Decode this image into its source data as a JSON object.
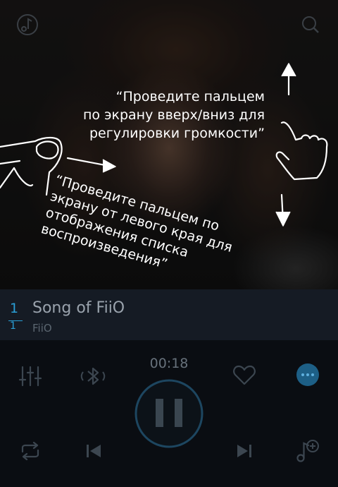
{
  "header": {
    "left_icon": "music-note-icon",
    "right_icon": "search-icon"
  },
  "hints": {
    "volume": "“Проведите пальцем\nпо экрану вверх/вниз для\nрегулировки громкости”",
    "playlist": "“Проведите пальцем по\nэкрану от левого края для\nотображения списка\nвоспроизведения”"
  },
  "track": {
    "number": "1",
    "number_secondary": "1",
    "title": "Song of FiiO",
    "artist": "FiiO"
  },
  "player": {
    "time": "00:18",
    "accent_color": "#2a9fd6",
    "icons": [
      "equalizer-icon",
      "bluetooth-icon",
      "heart-icon",
      "more-icon",
      "pause-icon",
      "repeat-icon",
      "previous-icon",
      "next-icon",
      "add-to-playlist-icon"
    ]
  }
}
